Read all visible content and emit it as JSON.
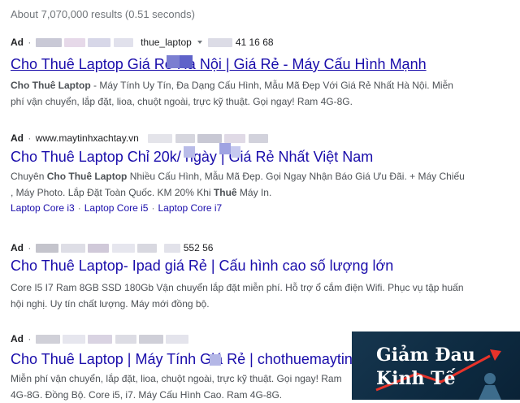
{
  "stats": "About 7,070,000 results (0.51 seconds)",
  "results": [
    {
      "ad": "Ad",
      "url_text": "thue_laptop",
      "phone_text": "41 16 68",
      "title": "Cho Thuê Laptop Giá Rẻ Hà Nội | Giá Rẻ - Máy Cấu Hình Mạnh",
      "desc_bold": "Cho Thuê Laptop",
      "desc_rest": " - Máy Tính Uy Tín, Đa Dạng Cấu Hình, Mẫu Mã Đẹp Với Giá Rẻ Nhất Hà Nội. Miễn phí vận chuyển, lắp đặt, lioa, chuột ngoài, trực kỹ thuật. Gọi ngay! Ram 4G-8G."
    },
    {
      "ad": "Ad",
      "url_text": "www.maytinhxachtay.vn",
      "title": "Cho Thuê Laptop Chỉ 20k/ ngày | Giá Rẻ Nhất Việt Nam",
      "desc_pre": "Chuyên ",
      "desc_bold": "Cho Thuê Laptop",
      "desc_mid": " Nhiều Cấu Hình, Mẫu Mã Đẹp. Gọi Ngay Nhận Báo Giá Ưu Đãi. + Máy Chiếu , Máy Photo. Lắp Đặt Toàn Quốc. KM 20% Khi ",
      "desc_bold2": "Thuê",
      "desc_end": " Máy In.",
      "sitelinks": [
        "Laptop Core i3",
        "Laptop Core i5",
        "Laptop Core i7"
      ],
      "sitelink_sep": "·"
    },
    {
      "ad": "Ad",
      "phone_text": "552 56",
      "title": "Cho Thuê Laptop- Ipad giá Rẻ | Cấu hình cao số lượng lớn",
      "desc": "Core I5 I7 Ram 8GB SSD 180Gb Vận chuyển lắp đặt miễn phí. Hỗ trợ ổ cắm điện Wifi. Phục vụ tập huấn hội nghị. Uy tín chất lượng. Máy mới đồng bộ."
    },
    {
      "ad": "Ad",
      "title": "Cho Thuê Laptop | Máy Tính Giá Rẻ | chothuemaytinh",
      "desc": "Miễn phí vận chuyển, lắp đặt, lioa, chuột ngoài, trực kỹ thuật. Gọi ngay! Ram 4G-8G. Đồng Bộ. Core i5, i7. Máy Cấu Hình Cao. Ram 4G-8G."
    }
  ],
  "ad_dot": "·",
  "logo": {
    "line1": "Giảm Đau",
    "line2": "Kinh Tế",
    "bg": "#16364f",
    "arrow_color": "#e8332a"
  }
}
